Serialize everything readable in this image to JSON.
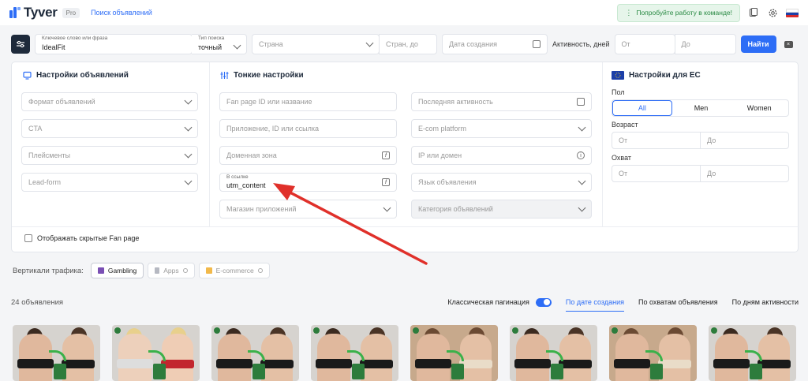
{
  "header": {
    "logo_text": "Tyver",
    "pro_badge": "Pro",
    "nav_link": "Поиск объявлений",
    "team_button": "Попробуйте работу в команде!",
    "colors": {
      "brand": "#2d6df6",
      "team_green": "#2a8a44"
    }
  },
  "search": {
    "keyword_label": "Ключевое слово или фраза",
    "keyword_value": "IdealFit",
    "search_type_label": "Тип поиска",
    "search_type_value": "точный",
    "country_placeholder": "Страна",
    "countries_to_placeholder": "Стран, до",
    "created_date_placeholder": "Дата создания",
    "activity_label": "Активность, дней",
    "from_placeholder": "От",
    "to_placeholder": "До",
    "submit_label": "Найти"
  },
  "ad_settings": {
    "title": "Настройки объявлений",
    "selects": [
      "Формат объявлений",
      "CTA",
      "Плейсменты",
      "Lead-form"
    ]
  },
  "fine_settings": {
    "title": "Тонкие настройки",
    "fan_page": "Fan page ID или название",
    "app": "Приложение, ID или ссылка",
    "domain_zone": "Доменная зона",
    "in_link_label": "В ссылке",
    "in_link_value": "utm_content",
    "app_store": "Магазин приложений",
    "last_activity": "Последняя активность",
    "ecom_platform": "E-com platform",
    "ip_domain": "IP или домен",
    "ad_language": "Язык объявления",
    "ad_category": "Категория объявлений"
  },
  "eu_settings": {
    "title": "Настройки для ЕС",
    "gender_label": "Пол",
    "gender_options": [
      "All",
      "Men",
      "Women"
    ],
    "gender_selected": "All",
    "age_label": "Возраст",
    "reach_label": "Охват",
    "from": "От",
    "to": "До"
  },
  "hidden_fanpages": "Отображать скрытые Fan page",
  "verticals": {
    "title": "Вертикали трафика:",
    "items": [
      {
        "label": "Gambling",
        "active": true
      },
      {
        "label": "Apps",
        "active": false
      },
      {
        "label": "E-commerce",
        "active": false
      }
    ]
  },
  "results": {
    "count": "24 объявления",
    "classic_pagination": "Классическая пагинация",
    "sort_options": [
      "По дате создания",
      "По охватам объявления",
      "По дням активности"
    ],
    "sort_selected": "По дате создания"
  }
}
